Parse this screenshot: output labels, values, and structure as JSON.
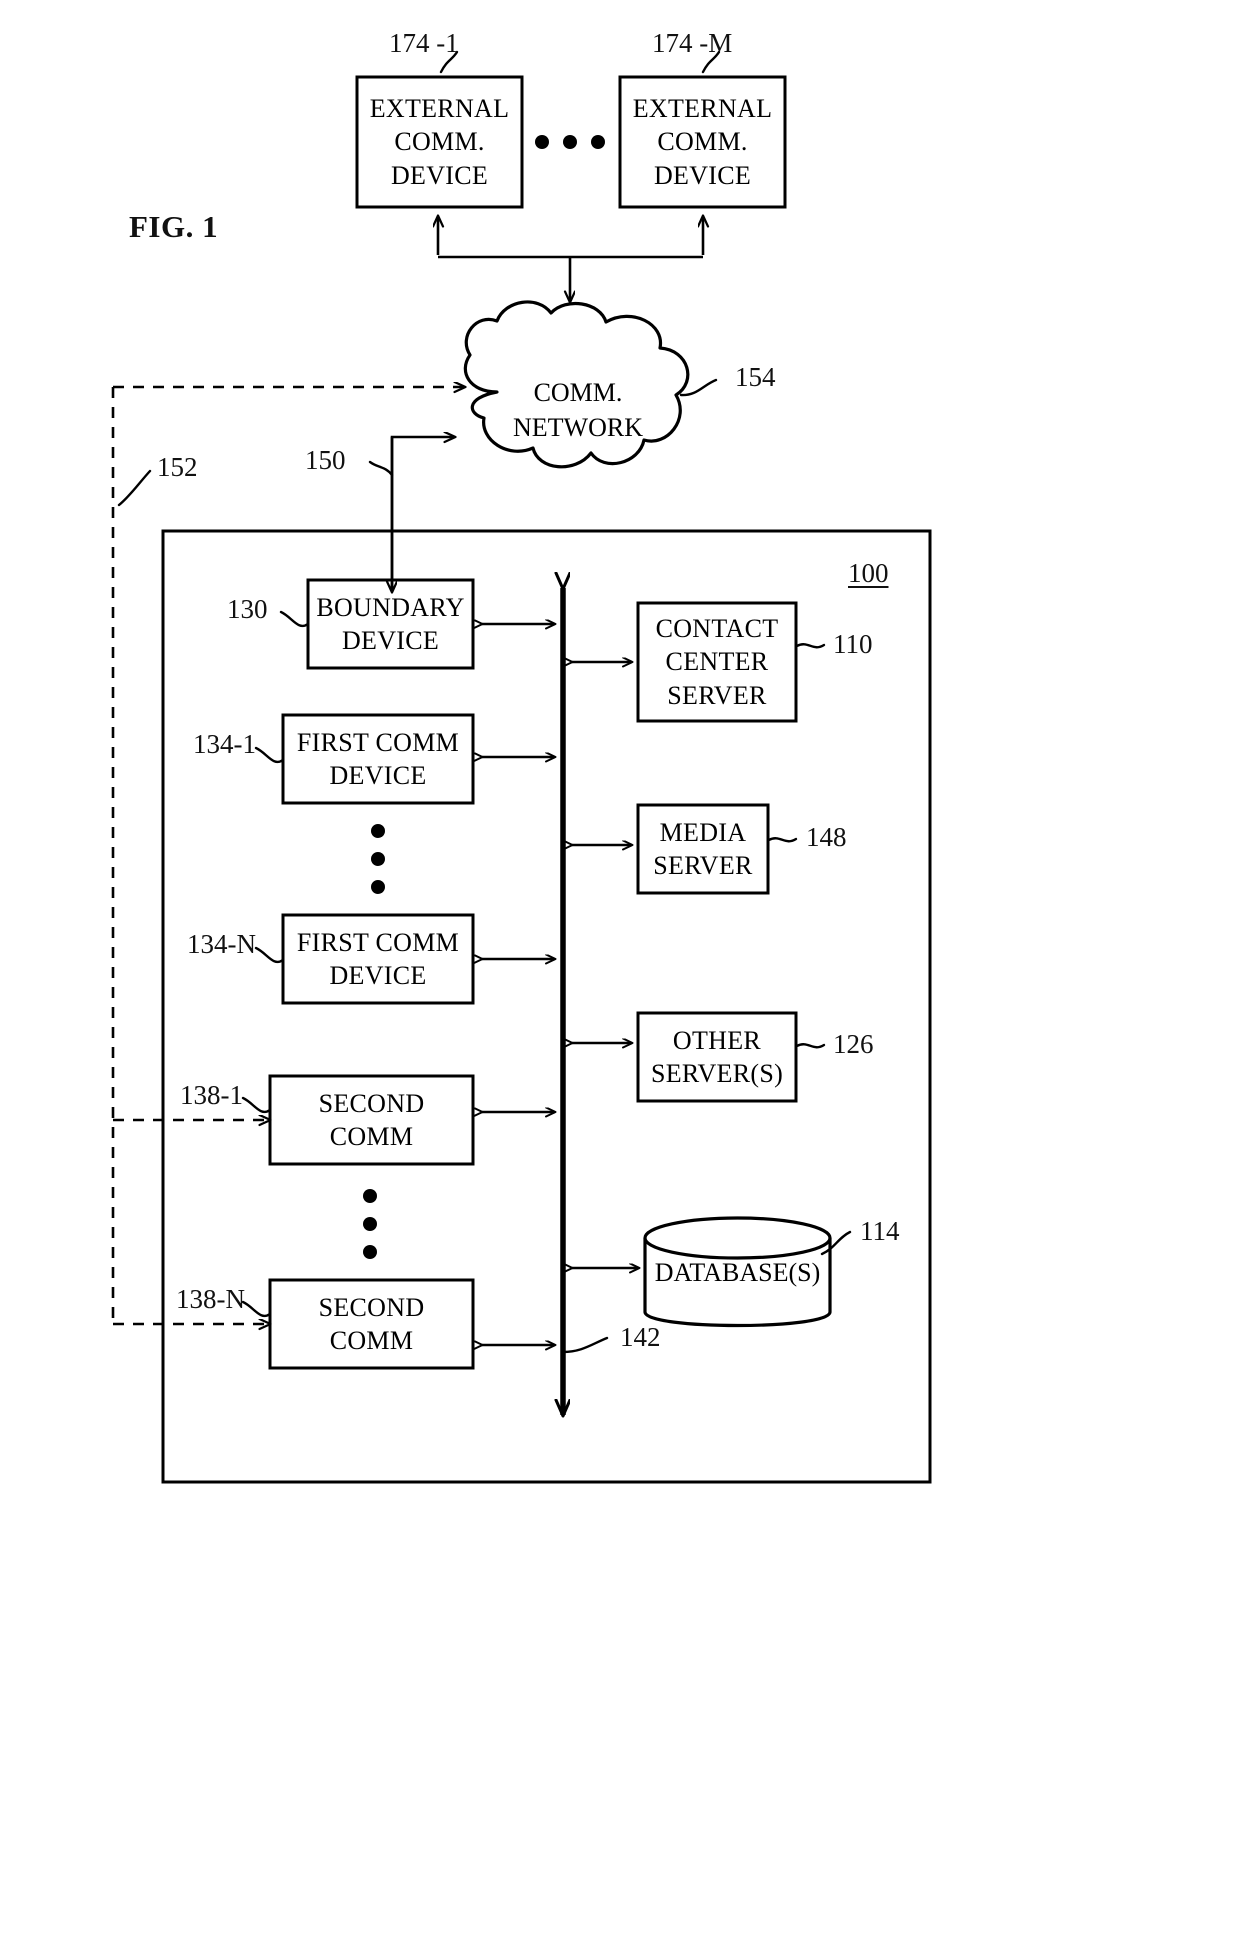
{
  "figure": {
    "title": "FIG. 1",
    "system_ref": "100"
  },
  "external_devices": [
    {
      "ref": "174 -1",
      "lines": [
        "EXTERNAL",
        "COMM.",
        "DEVICE"
      ]
    },
    {
      "ref": "174 -M",
      "lines": [
        "EXTERNAL",
        "COMM.",
        "DEVICE"
      ]
    }
  ],
  "ellipsis_between_external": "•  •  •",
  "network": {
    "ref": "154",
    "lines": [
      "COMM.",
      "NETWORK"
    ]
  },
  "connections": {
    "dashed_path_ref": "152",
    "boundary_link_ref": "150",
    "bus_ref": "142"
  },
  "left_column": [
    {
      "ref": "130",
      "lines": [
        "BOUNDARY",
        "DEVICE"
      ]
    },
    {
      "ref": "134-1",
      "lines": [
        "FIRST COMM",
        "DEVICE"
      ]
    },
    {
      "ref": "134-N",
      "lines": [
        "FIRST COMM",
        "DEVICE"
      ]
    },
    {
      "ref": "138-1",
      "lines": [
        "SECOND",
        "COMM"
      ]
    },
    {
      "ref": "138-N",
      "lines": [
        "SECOND",
        "COMM"
      ]
    }
  ],
  "right_column": [
    {
      "ref": "110",
      "lines": [
        "CONTACT",
        "CENTER",
        "SERVER"
      ]
    },
    {
      "ref": "148",
      "lines": [
        "MEDIA",
        "SERVER"
      ]
    },
    {
      "ref": "126",
      "lines": [
        "OTHER",
        "SERVER(S)"
      ]
    },
    {
      "ref": "114",
      "lines": [
        "DATABASE(S)"
      ]
    }
  ],
  "vertical_ellipsis": "•"
}
